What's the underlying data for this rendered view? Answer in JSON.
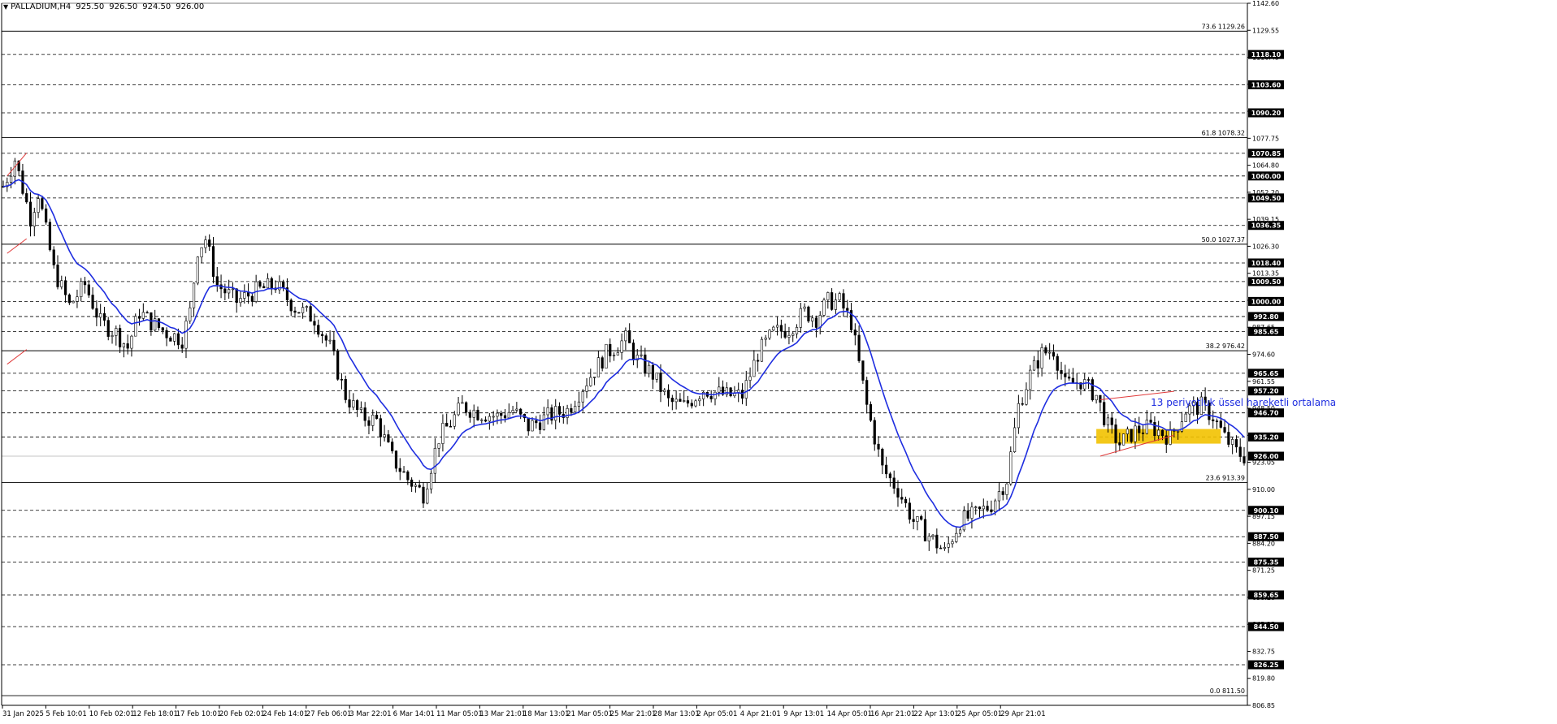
{
  "header": {
    "symbol": "PALLADIUM,H4",
    "open": "925.50",
    "high": "926.50",
    "low": "924.50",
    "close": "926.00"
  },
  "annotation": "13 periyotluk üssel hareketli ortalama",
  "colors": {
    "candle": "#000000",
    "ema": "#1f2ee0",
    "channel": "#e03a3a",
    "zone": "#f2c200",
    "badge": "#000000",
    "annotation": "#1f2ee0"
  },
  "chart_data": {
    "type": "candlestick",
    "ylim": [
      806.85,
      1142.6
    ],
    "y_ticks": [
      "1142.60",
      "1129.55",
      "1116.45",
      "1103.40",
      "1090.35",
      "1077.75",
      "1064.80",
      "1052.20",
      "1039.15",
      "1026.30",
      "1013.35",
      "1000.70",
      "987.65",
      "974.60",
      "961.55",
      "948.50",
      "935.45",
      "923.05",
      "910.00",
      "897.15",
      "884.20",
      "871.25",
      "858.20",
      "845.25",
      "832.75",
      "819.80",
      "806.85"
    ],
    "x_ticks": [
      "31 Jan 2025",
      "5 Feb 10:01",
      "10 Feb 02:01",
      "12 Feb 18:01",
      "17 Feb 10:01",
      "20 Feb 02:01",
      "24 Feb 14:01",
      "27 Feb 06:01",
      "3 Mar 22:01",
      "6 Mar 14:01",
      "11 Mar 05:01",
      "13 Mar 21:01",
      "18 Mar 13:01",
      "21 Mar 05:01",
      "25 Mar 21:01",
      "28 Mar 13:01",
      "2 Apr 05:01",
      "4 Apr 21:01",
      "9 Apr 13:01",
      "14 Apr 05:01",
      "16 Apr 21:01",
      "22 Apr 13:01",
      "25 Apr 05:01",
      "29 Apr 21:01"
    ],
    "price_levels": [
      {
        "value": 1118.1,
        "label": "1118.10"
      },
      {
        "value": 1103.6,
        "label": "1103.60"
      },
      {
        "value": 1090.2,
        "label": "1090.20"
      },
      {
        "value": 1070.85,
        "label": "1070.85"
      },
      {
        "value": 1060.0,
        "label": "1060.00"
      },
      {
        "value": 1049.5,
        "label": "1049.50"
      },
      {
        "value": 1036.35,
        "label": "1036.35"
      },
      {
        "value": 1018.4,
        "label": "1018.40"
      },
      {
        "value": 1009.5,
        "label": "1009.50"
      },
      {
        "value": 1000.0,
        "label": "1000.00"
      },
      {
        "value": 992.8,
        "label": "992.80"
      },
      {
        "value": 985.65,
        "label": "985.65"
      },
      {
        "value": 965.65,
        "label": "965.65"
      },
      {
        "value": 957.2,
        "label": "957.20"
      },
      {
        "value": 946.7,
        "label": "946.70"
      },
      {
        "value": 935.2,
        "label": "935.20"
      },
      {
        "value": 900.1,
        "label": "900.10"
      },
      {
        "value": 887.5,
        "label": "887.50"
      },
      {
        "value": 875.35,
        "label": "875.35"
      },
      {
        "value": 859.65,
        "label": "859.65"
      },
      {
        "value": 844.5,
        "label": "844.50"
      },
      {
        "value": 826.25,
        "label": "826.25"
      }
    ],
    "current_price": {
      "value": 926.0,
      "label": "926.00"
    },
    "fibonacci": [
      {
        "value": 1129.26,
        "label": "73.6 1129.26"
      },
      {
        "value": 1078.32,
        "label": "61.8 1078.32"
      },
      {
        "value": 1027.37,
        "label": "50.0 1027.37"
      },
      {
        "value": 976.42,
        "label": "38.2 976.42"
      },
      {
        "value": 913.39,
        "label": "23.6 913.39"
      },
      {
        "value": 811.5,
        "label": "0.0 811.50"
      }
    ],
    "price_path": [
      [
        0,
        1055
      ],
      [
        3,
        1068
      ],
      [
        7,
        1040
      ],
      [
        9,
        1052
      ],
      [
        13,
        1015
      ],
      [
        17,
        998
      ],
      [
        21,
        1008
      ],
      [
        25,
        990
      ],
      [
        29,
        985
      ],
      [
        32,
        978
      ],
      [
        35,
        995
      ],
      [
        38,
        990
      ],
      [
        42,
        985
      ],
      [
        46,
        982
      ],
      [
        48,
        995
      ],
      [
        50,
        1025
      ],
      [
        52,
        1030
      ],
      [
        55,
        1008
      ],
      [
        60,
        1000
      ],
      [
        65,
        1005
      ],
      [
        70,
        1008
      ],
      [
        75,
        997
      ],
      [
        80,
        992
      ],
      [
        84,
        978
      ],
      [
        88,
        955
      ],
      [
        92,
        945
      ],
      [
        96,
        943
      ],
      [
        100,
        925
      ],
      [
        104,
        915
      ],
      [
        108,
        908
      ],
      [
        112,
        935
      ],
      [
        115,
        942
      ],
      [
        118,
        950
      ],
      [
        122,
        947
      ],
      [
        127,
        945
      ],
      [
        131,
        948
      ],
      [
        135,
        940
      ],
      [
        140,
        945
      ],
      [
        145,
        948
      ],
      [
        150,
        962
      ],
      [
        155,
        975
      ],
      [
        160,
        982
      ],
      [
        163,
        972
      ],
      [
        167,
        965
      ],
      [
        171,
        952
      ],
      [
        175,
        950
      ],
      [
        180,
        958
      ],
      [
        186,
        955
      ],
      [
        190,
        955
      ],
      [
        194,
        975
      ],
      [
        198,
        985
      ],
      [
        202,
        987
      ],
      [
        206,
        995
      ],
      [
        209,
        992
      ],
      [
        212,
        1000
      ],
      [
        215,
        1000
      ],
      [
        218,
        990
      ],
      [
        222,
        950
      ],
      [
        226,
        920
      ],
      [
        230,
        910
      ],
      [
        234,
        895
      ],
      [
        238,
        888
      ],
      [
        242,
        880
      ],
      [
        246,
        895
      ],
      [
        250,
        898
      ],
      [
        254,
        903
      ],
      [
        258,
        915
      ],
      [
        261,
        950
      ],
      [
        264,
        965
      ],
      [
        267,
        975
      ],
      [
        270,
        977
      ],
      [
        273,
        960
      ],
      [
        277,
        962
      ],
      [
        281,
        955
      ],
      [
        284,
        940
      ],
      [
        287,
        932
      ],
      [
        291,
        938
      ],
      [
        295,
        940
      ],
      [
        300,
        935
      ],
      [
        304,
        948
      ],
      [
        308,
        950
      ],
      [
        311,
        945
      ],
      [
        314,
        935
      ],
      [
        317,
        928
      ],
      [
        319,
        926
      ]
    ],
    "channel": {
      "upper": [
        [
          282,
          953
        ],
        [
          301,
          957
        ]
      ],
      "lower": [
        [
          282,
          926
        ],
        [
          301,
          936
        ]
      ]
    },
    "zone": {
      "x": [
        281,
        313
      ],
      "y": [
        932,
        939
      ]
    }
  }
}
